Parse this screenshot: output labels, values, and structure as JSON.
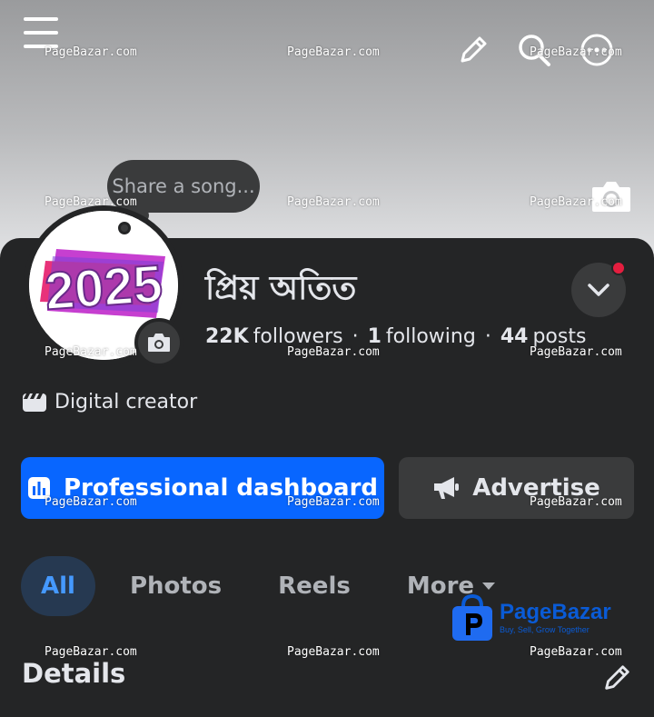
{
  "colors": {
    "accent": "#0866ff",
    "panel_bg": "#242526",
    "button_secondary": "#3a3b3c",
    "active_tab_text": "#4599ff",
    "notification_dot": "#e41e3f"
  },
  "header": {
    "icons": [
      "menu-icon",
      "pencil-icon",
      "search-icon",
      "more-icon"
    ]
  },
  "cover": {
    "camera_icon": "camera-icon"
  },
  "song_bubble": {
    "text": "Share a song..."
  },
  "profile": {
    "avatar_text": "2025",
    "name": "প্রিয় অতিত",
    "followers_count": "22K",
    "followers_label": "followers",
    "following_count": "1",
    "following_label": "following",
    "posts_count": "44",
    "posts_label": "posts",
    "separator": "·",
    "category": "Digital creator"
  },
  "actions": {
    "dashboard_label": "Professional dashboard",
    "advertise_label": "Advertise"
  },
  "tabs": [
    {
      "label": "All",
      "active": true
    },
    {
      "label": "Photos",
      "active": false
    },
    {
      "label": "Reels",
      "active": false
    },
    {
      "label": "More",
      "active": false
    }
  ],
  "details": {
    "heading": "Details"
  },
  "watermark": {
    "text": "PageBazar.com",
    "logo_name": "PageBazar",
    "logo_tagline": "Buy, Sell, Grow Together"
  }
}
